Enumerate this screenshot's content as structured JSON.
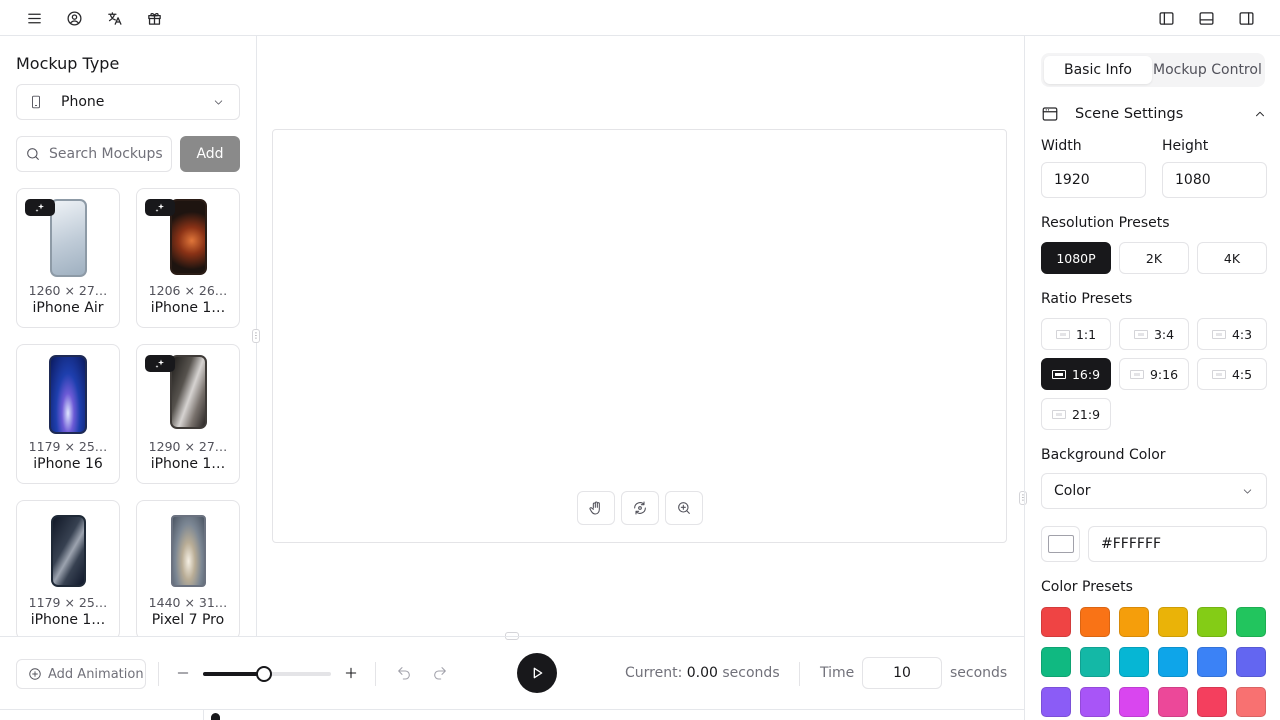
{
  "toolbar": {
    "left_icons": [
      "menu-icon",
      "user-circle-icon",
      "language-icon",
      "gift-icon"
    ],
    "right_icons": [
      "left-panel-toggle-icon",
      "bottom-panel-toggle-icon",
      "right-panel-toggle-icon"
    ]
  },
  "left_panel": {
    "title": "Mockup Type",
    "type_select": {
      "value": "Phone",
      "icon": "smartphone-icon"
    },
    "search": {
      "placeholder": "Search Mockups",
      "value": ""
    },
    "add_label": "Add",
    "mockups": [
      {
        "name": "iPhone Air",
        "dims": "1260 × 27…",
        "badge": true,
        "colors": [
          "#c4d0dc",
          "#e9eef3"
        ]
      },
      {
        "name": "iPhone 1…",
        "dims": "1206 × 26…",
        "badge": true,
        "colors": [
          "#1e1410",
          "#c2562a"
        ]
      },
      {
        "name": "iPhone 16",
        "dims": "1179 × 25…",
        "badge": false,
        "colors": [
          "#1c2f8f",
          "#3b82f6"
        ]
      },
      {
        "name": "iPhone 1…",
        "dims": "1290 × 27…",
        "badge": true,
        "colors": [
          "#2b2a28",
          "#a8a29e"
        ]
      },
      {
        "name": "iPhone 1…",
        "dims": "1179 × 25…",
        "badge": false,
        "colors": [
          "#1f2937",
          "#6b7280"
        ]
      },
      {
        "name": "Pixel 7 Pro",
        "dims": "1440 × 31…",
        "badge": false,
        "colors": [
          "#9ca3af",
          "#d6c7a9"
        ]
      }
    ]
  },
  "canvas": {
    "tools": [
      "hand-tool-icon",
      "rotate-view-icon",
      "zoom-in-icon"
    ],
    "background": "#FFFFFF"
  },
  "bottom_bar": {
    "add_animation_label": "Add Animation",
    "zoom_fraction": 0.48,
    "current_label": "Current:",
    "current_value": "0.00",
    "current_unit": "seconds",
    "time_label": "Time",
    "time_value": "10",
    "seconds_label": "seconds"
  },
  "right_panel": {
    "tabs": [
      {
        "label": "Basic Info",
        "active": true
      },
      {
        "label": "Mockup Controls",
        "active": false
      }
    ],
    "scene_settings_label": "Scene Settings",
    "width_label": "Width",
    "width_value": "1920",
    "height_label": "Height",
    "height_value": "1080",
    "resolution_label": "Resolution Presets",
    "resolution_presets": [
      {
        "label": "1080P",
        "active": true
      },
      {
        "label": "2K",
        "active": false
      },
      {
        "label": "4K",
        "active": false
      }
    ],
    "ratio_label": "Ratio Presets",
    "ratio_presets": [
      {
        "label": "1:1",
        "active": false
      },
      {
        "label": "3:4",
        "active": false
      },
      {
        "label": "4:3",
        "active": false
      },
      {
        "label": "16:9",
        "active": true
      },
      {
        "label": "9:16",
        "active": false
      },
      {
        "label": "4:5",
        "active": false
      },
      {
        "label": "21:9",
        "active": false
      }
    ],
    "background_label": "Background Color",
    "background_type": "Color",
    "background_hex": "#FFFFFF",
    "color_presets_label": "Color Presets",
    "color_presets": [
      "#ef4444",
      "#f97316",
      "#f59e0b",
      "#eab308",
      "#84cc16",
      "#22c55e",
      "#10b981",
      "#14b8a6",
      "#06b6d4",
      "#0ea5e9",
      "#3b82f6",
      "#6366f1",
      "#8b5cf6",
      "#a855f7",
      "#d946ef",
      "#ec4899",
      "#f43f5e",
      "#f87171"
    ]
  }
}
